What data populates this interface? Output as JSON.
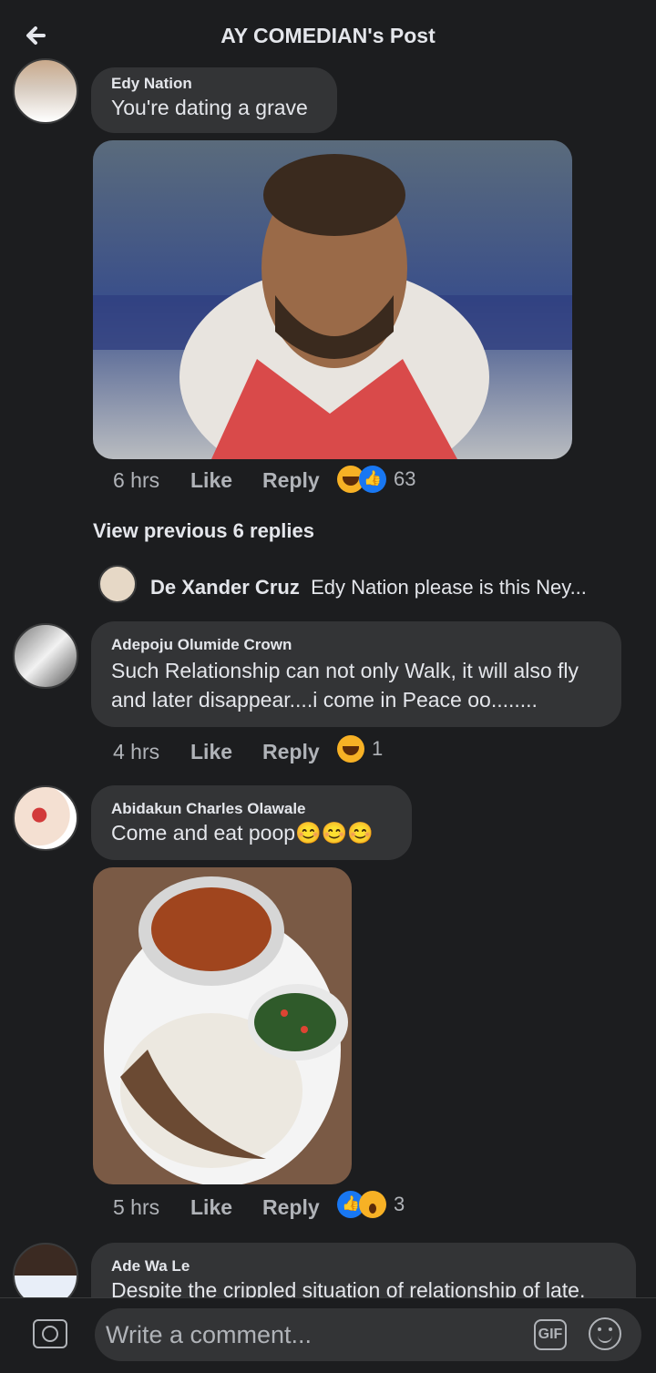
{
  "header": {
    "title": "AY COMEDIAN's Post"
  },
  "comments": [
    {
      "author": "Edy Nation",
      "text": "You're dating a grave",
      "time": "6 hrs",
      "like": "Like",
      "reply": "Reply",
      "reaction_count": "63",
      "reactions": [
        "haha-icon",
        "like-icon"
      ],
      "attachment": "photo of a footballer pouting"
    },
    {
      "author": "Adepoju Olumide Crown",
      "text_line1": "Such Relationship can not only Walk, it will also fly",
      "text_line2": "and later disappear....i come in Peace oo........",
      "time": "4 hrs",
      "like": "Like",
      "reply": "Reply",
      "reaction_count": "1",
      "reactions": [
        "haha-icon"
      ]
    },
    {
      "author": "Abidakun Charles Olawale",
      "text": "Come and eat poop😊😊😊",
      "time": "5 hrs",
      "like": "Like",
      "reply": "Reply",
      "reaction_count": "3",
      "reactions": [
        "like-icon",
        "wow-icon"
      ],
      "attachment": "plate of rice, beans, chicken and vegetables"
    },
    {
      "author": "Ade Wa Le",
      "text": "Despite the crippled situation of relationship of late,"
    }
  ],
  "view_previous": "View previous 6 replies",
  "reply_preview": {
    "author": "De Xander Cruz",
    "text": "Edy Nation please is this Ney..."
  },
  "composer": {
    "placeholder": "Write a comment...",
    "gif_label": "GIF"
  },
  "colors": {
    "background": "#1c1d1f",
    "bubble": "#333436",
    "text": "#e4e6eb",
    "muted": "#b0b3b8",
    "like_blue": "#1877f2"
  }
}
